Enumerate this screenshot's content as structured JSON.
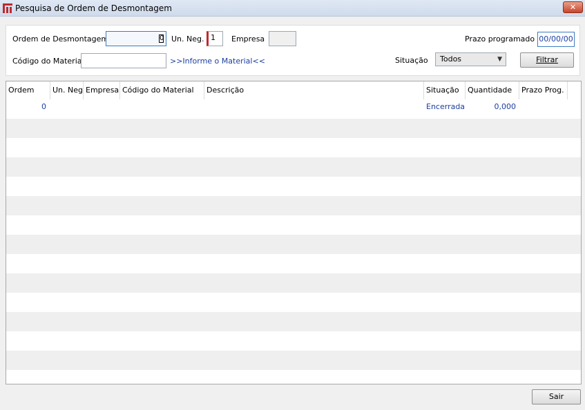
{
  "window": {
    "title": "Pesquisa de Ordem de Desmontagem",
    "close_label": "✕"
  },
  "filters": {
    "ordem_label": "Ordem de Desmontagem",
    "ordem_value": "0",
    "un_neg_label": "Un. Neg.",
    "un_neg_value": "1",
    "empresa_label": "Empresa",
    "empresa_value": "",
    "prazo_label": "Prazo programado",
    "prazo_value": "00/00/00",
    "material_label": "Código do Material",
    "material_value": "",
    "material_link": ">>Informe o Material<<",
    "situacao_label": "Situação",
    "situacao_selected": "Todos",
    "filtrar_label": "Filtrar"
  },
  "grid": {
    "columns": [
      "Ordem",
      "Un. Neg.",
      "Empresa",
      "Código do Material",
      "Descrição",
      "Situação",
      "Quantidade",
      "Prazo Prog."
    ],
    "rows": [
      [
        "0",
        "",
        "",
        "",
        "",
        "Encerrada",
        "0,000",
        ""
      ]
    ]
  },
  "footer": {
    "sair_label": "Sair"
  },
  "colors": {
    "link": "#1a3fa0",
    "required_marker": "#c0282d",
    "alt_row": "#efefef"
  }
}
